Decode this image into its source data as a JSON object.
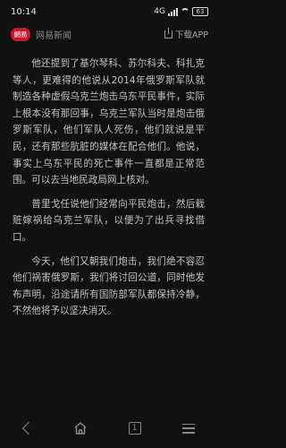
{
  "status": {
    "time": "10:14",
    "network": "4G",
    "battery": "63"
  },
  "header": {
    "logo_text": "網易",
    "app_name": "网易新闻",
    "download_label": "下载APP"
  },
  "article": {
    "paragraphs": [
      "他还提到了基尔琴科、苏尔科夫、科扎克等人，更难得的他说从2014年俄罗斯军队就制造各种虚假乌克兰炮击乌东平民事件，实际上根本没有那回事，乌克兰军队当时是炮击俄罗斯军队，他们军队人死伤，他们就说是平民，还有那些肮脏的媒体在配合他们。他说，事实上乌东平民的死亡事件一直都是正常范围。可以去当地民政局网上核对。",
      "普里戈任说他们经常向平民炮击，然后栽赃嫁祸给乌克兰军队，以便为了出兵寻找借口。",
      "今天，他们又朝我们炮击，我们绝不容忍他们祸害俄罗斯，我们将讨回公道，同时他发布声明，沿途请所有国防部军队都保持冷静，不然他将予以坚决消灭。"
    ]
  },
  "nav": {
    "tab_count": "1"
  },
  "icons": [
    "signal-icon",
    "wifi-icon",
    "battery-icon",
    "download-icon",
    "back-icon",
    "home-icon",
    "tabs-icon",
    "menu-icon"
  ]
}
